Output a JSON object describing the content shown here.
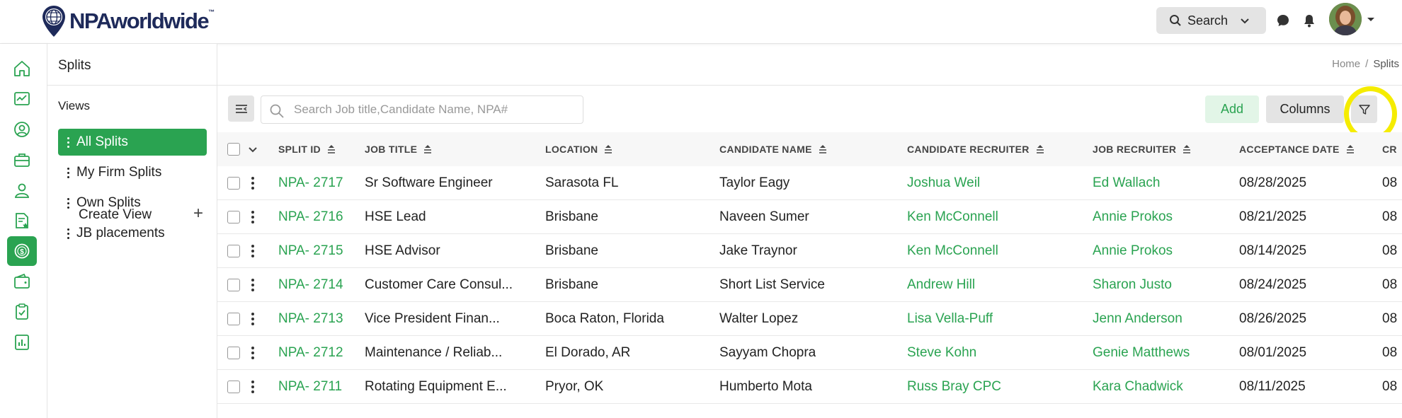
{
  "brand": {
    "name": "NPAworldwide",
    "tm": "™"
  },
  "header": {
    "search_label": "Search"
  },
  "sidebar": {
    "title": "Splits",
    "views_label": "Views",
    "items": [
      {
        "label": "All Splits",
        "active": true
      },
      {
        "label": "My Firm Splits",
        "active": false
      },
      {
        "label": "Own Splits",
        "active": false
      },
      {
        "label": "JB placements",
        "active": false
      }
    ],
    "create_view": "Create View"
  },
  "breadcrumb": {
    "home": "Home",
    "sep": "/",
    "current": "Splits"
  },
  "toolbar": {
    "search_placeholder": "Search Job title,Candidate Name, NPA#",
    "add_label": "Add",
    "columns_label": "Columns"
  },
  "table": {
    "columns": [
      "SPLIT ID",
      "JOB TITLE",
      "LOCATION",
      "CANDIDATE NAME",
      "CANDIDATE RECRUITER",
      "JOB RECRUITER",
      "ACCEPTANCE DATE",
      "CR"
    ],
    "rows": [
      {
        "id": "NPA- 2717",
        "title": "Sr Software Engineer",
        "location": "Sarasota FL",
        "candidate": "Taylor Eagy",
        "cand_recruiter": "Joshua Weil",
        "job_recruiter": "Ed Wallach",
        "date": "08/28/2025",
        "cr": "08"
      },
      {
        "id": "NPA- 2716",
        "title": "HSE Lead",
        "location": "Brisbane",
        "candidate": "Naveen Sumer",
        "cand_recruiter": "Ken McConnell",
        "job_recruiter": "Annie Prokos",
        "date": "08/21/2025",
        "cr": "08"
      },
      {
        "id": "NPA- 2715",
        "title": "HSE Advisor",
        "location": "Brisbane",
        "candidate": "Jake Traynor",
        "cand_recruiter": "Ken McConnell",
        "job_recruiter": "Annie Prokos",
        "date": "08/14/2025",
        "cr": "08"
      },
      {
        "id": "NPA- 2714",
        "title": "Customer Care Consul...",
        "location": "Brisbane",
        "candidate": "Short List Service",
        "cand_recruiter": "Andrew Hill",
        "job_recruiter": "Sharon Justo",
        "date": "08/24/2025",
        "cr": "08"
      },
      {
        "id": "NPA- 2713",
        "title": "Vice President Finan...",
        "location": "Boca Raton, Florida",
        "candidate": "Walter Lopez",
        "cand_recruiter": "Lisa Vella-Puff",
        "job_recruiter": "Jenn Anderson",
        "date": "08/26/2025",
        "cr": "08"
      },
      {
        "id": "NPA- 2712",
        "title": "Maintenance / Reliab...",
        "location": "El Dorado, AR",
        "candidate": "Sayyam Chopra",
        "cand_recruiter": "Steve Kohn",
        "job_recruiter": "Genie Matthews",
        "date": "08/01/2025",
        "cr": "08"
      },
      {
        "id": "NPA- 2711",
        "title": "Rotating Equipment E...",
        "location": "Pryor, OK",
        "candidate": "Humberto Mota",
        "cand_recruiter": "Russ Bray CPC",
        "job_recruiter": "Kara Chadwick",
        "date": "08/11/2025",
        "cr": "08"
      }
    ]
  },
  "colors": {
    "accent": "#2aa351",
    "highlight": "#f5ec00"
  },
  "icons": [
    "home-icon",
    "dashboard-icon",
    "profile-icon",
    "briefcase-icon",
    "contacts-icon",
    "document-star-icon",
    "dollar-icon",
    "wallet-icon",
    "clipboard-check-icon",
    "reports-icon"
  ]
}
